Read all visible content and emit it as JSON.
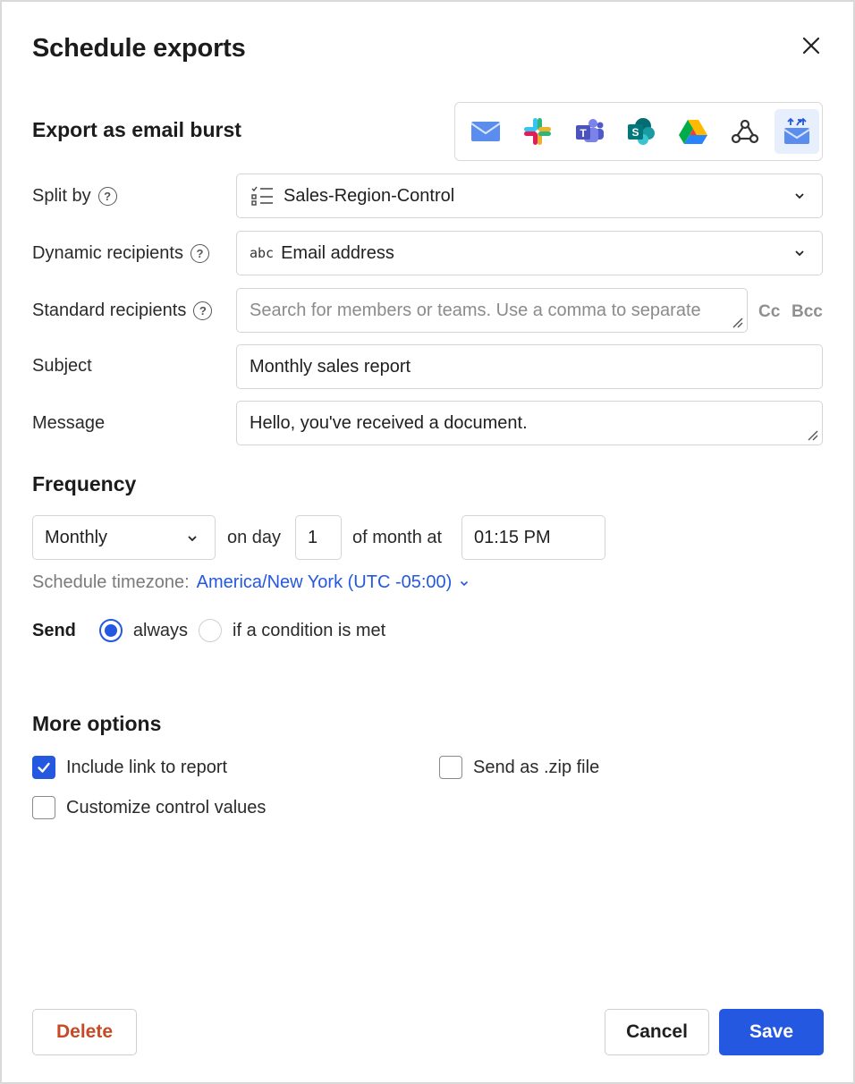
{
  "dialog": {
    "title": "Schedule exports",
    "close_icon": "close-icon"
  },
  "destination": {
    "heading": "Export as email burst",
    "options": [
      {
        "name": "email-icon",
        "active": false
      },
      {
        "name": "slack-icon",
        "active": false
      },
      {
        "name": "teams-icon",
        "active": false
      },
      {
        "name": "sharepoint-icon",
        "active": false
      },
      {
        "name": "google-drive-icon",
        "active": false
      },
      {
        "name": "webhook-icon",
        "active": false
      },
      {
        "name": "email-burst-icon",
        "active": true
      }
    ]
  },
  "form": {
    "split_by": {
      "label": "Split by",
      "value": "Sales-Region-Control"
    },
    "dynamic_recipients": {
      "label": "Dynamic recipients",
      "type_tag": "abc",
      "value": "Email address"
    },
    "standard_recipients": {
      "label": "Standard recipients",
      "placeholder": "Search for members or teams. Use a comma to separate",
      "cc": "Cc",
      "bcc": "Bcc"
    },
    "subject": {
      "label": "Subject",
      "value": "Monthly sales report"
    },
    "message": {
      "label": "Message",
      "value": "Hello, you've received a document."
    }
  },
  "frequency": {
    "heading": "Frequency",
    "period": "Monthly",
    "on_day_label": "on day",
    "day": "1",
    "of_month_label": "of month at",
    "time": "01:15 PM",
    "timezone_label": "Schedule timezone:",
    "timezone": "America/New York (UTC -05:00)"
  },
  "send": {
    "label": "Send",
    "options": [
      {
        "label": "always",
        "selected": true
      },
      {
        "label": "if a condition is met",
        "selected": false
      }
    ]
  },
  "more_options": {
    "heading": "More options",
    "include_link": {
      "label": "Include link to report",
      "checked": true
    },
    "send_zip": {
      "label": "Send as .zip file",
      "checked": false
    },
    "customize_controls": {
      "label": "Customize control values",
      "checked": false
    }
  },
  "footer": {
    "delete": "Delete",
    "cancel": "Cancel",
    "save": "Save"
  },
  "colors": {
    "accent": "#2458e0",
    "danger": "#c64a25",
    "border": "#d4d4d4"
  }
}
